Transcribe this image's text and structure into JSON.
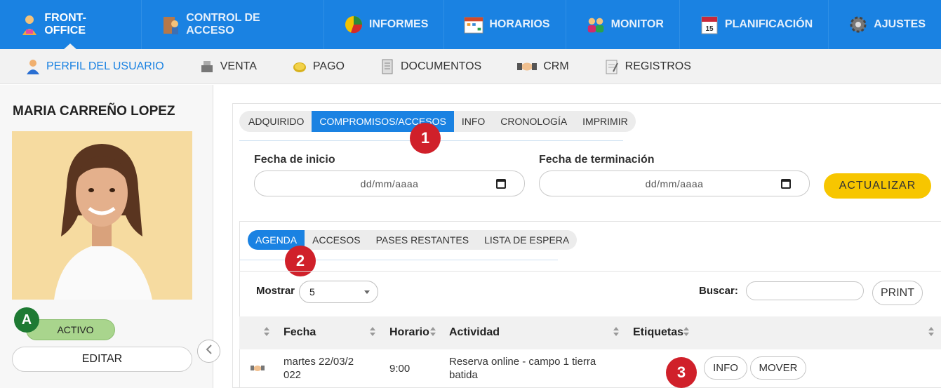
{
  "topnav": {
    "items": [
      {
        "label": "FRONT-OFFICE",
        "icon": "receptionist-icon",
        "active": true
      },
      {
        "label": "CONTROL DE ACCESO",
        "icon": "access-control-icon"
      },
      {
        "label": "INFORMES",
        "icon": "pie-chart-icon"
      },
      {
        "label": "HORARIOS",
        "icon": "calendar-grid-icon"
      },
      {
        "label": "MONITOR",
        "icon": "users-group-icon"
      },
      {
        "label": "PLANIFICACIÓN",
        "icon": "calendar-day-icon"
      },
      {
        "label": "AJUSTES",
        "icon": "gear-icon"
      }
    ]
  },
  "subnav": {
    "items": [
      {
        "label": "PERFIL DEL USUARIO",
        "icon": "user-icon",
        "active": true
      },
      {
        "label": "VENTA",
        "icon": "cash-register-icon"
      },
      {
        "label": "PAGO",
        "icon": "coin-icon"
      },
      {
        "label": "DOCUMENTOS",
        "icon": "document-icon"
      },
      {
        "label": "CRM",
        "icon": "handshake-icon"
      },
      {
        "label": "REGISTROS",
        "icon": "notepad-icon"
      }
    ]
  },
  "profile": {
    "name": "MARIA CARREÑO LOPEZ",
    "status": "ACTIVO",
    "status_marker": "A",
    "edit_label": "EDITAR"
  },
  "tabs_main": [
    "ADQUIRIDO",
    "COMPROMISOS/ACCESOS",
    "INFO",
    "CRONOLOGÍA",
    "IMPRIMIR"
  ],
  "tabs_main_active": "COMPROMISOS/ACCESOS",
  "filters": {
    "start_label": "Fecha de inicio",
    "start_placeholder": "dd/mm/aaaa",
    "end_label": "Fecha de terminación",
    "end_placeholder": "dd/mm/aaaa",
    "update_label": "ACTUALIZAR"
  },
  "tabs_sub": [
    "AGENDA",
    "ACCESOS",
    "PASES RESTANTES",
    "LISTA DE ESPERA"
  ],
  "tabs_sub_active": "AGENDA",
  "table_controls": {
    "show_label": "Mostrar",
    "show_value": "5",
    "search_label": "Buscar:",
    "print_label": "PRINT"
  },
  "table": {
    "headers": [
      "Fecha",
      "Horario",
      "Actividad",
      "Etiquetas"
    ],
    "rows": [
      {
        "icon": "handshake-icon",
        "fecha": "martes 22/03/2\n022",
        "horario": "9:00",
        "actividad": "Reserva online - campo 1 tierra batida",
        "etiquetas": "",
        "actions": [
          "INFO",
          "MOVER"
        ]
      }
    ]
  },
  "markers": [
    "1",
    "2",
    "3"
  ],
  "colors": {
    "primary": "#1a82e2",
    "accent": "#f7c600",
    "status_green": "#a9d58d",
    "marker_red": "#d0202a",
    "marker_green": "#1e7a33"
  }
}
